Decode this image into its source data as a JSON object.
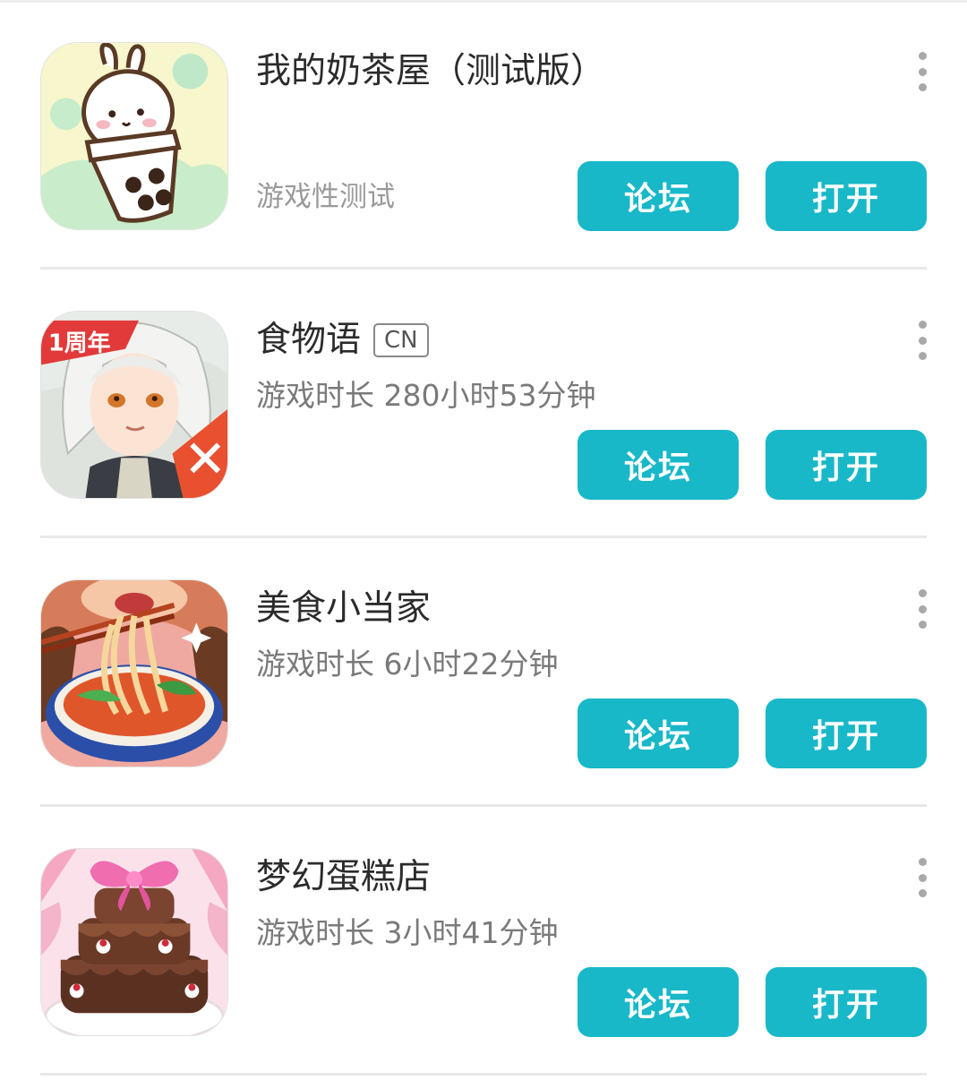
{
  "apps": [
    {
      "title": "我的奶茶屋（测试版）",
      "tag": "",
      "subtitle": "游戏性测试",
      "forum_label": "论坛",
      "open_label": "打开",
      "icon": "milk-tea-bunny-icon"
    },
    {
      "title": "食物语",
      "tag": "CN",
      "subtitle": "游戏时长 280小时53分钟",
      "forum_label": "论坛",
      "open_label": "打开",
      "icon": "anime-character-icon",
      "icon_banner": "1周年"
    },
    {
      "title": "美食小当家",
      "tag": "",
      "subtitle": "游戏时长 6小时22分钟",
      "forum_label": "论坛",
      "open_label": "打开",
      "icon": "noodle-bowl-icon"
    },
    {
      "title": "梦幻蛋糕店",
      "tag": "",
      "subtitle": "游戏时长 3小时41分钟",
      "forum_label": "论坛",
      "open_label": "打开",
      "icon": "cake-icon"
    }
  ],
  "colors": {
    "button": "#18b8c8",
    "button_text": "#ffffff",
    "title": "#2b2b2b",
    "subtitle": "#7a7a7a",
    "divider": "#e8e8e8"
  }
}
